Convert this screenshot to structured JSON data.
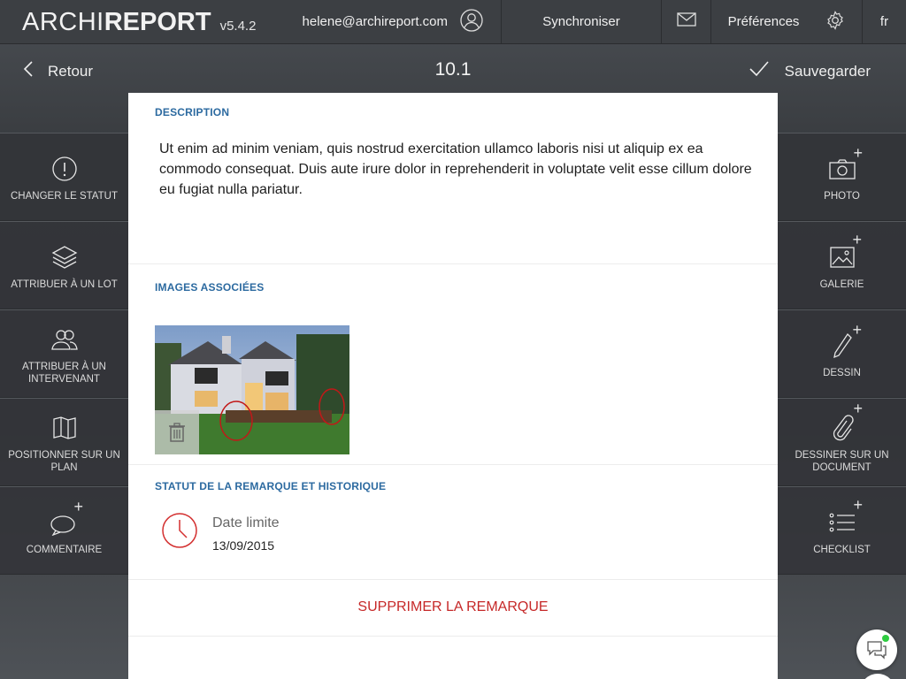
{
  "topbar": {
    "brand_light": "ARCHI",
    "brand_bold": "REPORT",
    "version": "v5.4.2",
    "user_email": "helene@archireport.com",
    "sync_label": "Synchroniser",
    "prefs_label": "Préférences",
    "lang": "fr"
  },
  "navbar": {
    "back_label": "Retour",
    "title": "10.1",
    "save_label": "Sauvegarder"
  },
  "left_actions": [
    {
      "label": "CHANGER LE STATUT",
      "icon": "alert-circle-icon"
    },
    {
      "label": "ATTRIBUER À UN LOT",
      "icon": "layers-icon"
    },
    {
      "label": "ATTRIBUER À UN INTERVENANT",
      "icon": "users-icon"
    },
    {
      "label": "POSITIONNER SUR UN PLAN",
      "icon": "map-icon"
    },
    {
      "label": "COMMENTAIRE",
      "icon": "comment-add-icon"
    }
  ],
  "right_actions": [
    {
      "label": "PHOTO",
      "icon": "camera-add-icon"
    },
    {
      "label": "GALERIE",
      "icon": "gallery-add-icon"
    },
    {
      "label": "DESSIN",
      "icon": "pencil-add-icon"
    },
    {
      "label": "DESSINER SUR UN DOCUMENT",
      "icon": "paperclip-add-icon"
    },
    {
      "label": "CHECKLIST",
      "icon": "checklist-add-icon"
    }
  ],
  "sheet": {
    "description_title": "DESCRIPTION",
    "description_text": "Ut enim ad minim veniam, quis nostrud exercitation ullamco laboris nisi ut aliquip ex ea commodo consequat. Duis aute irure dolor in reprehenderit in voluptate velit esse cillum dolore eu fugiat nulla pariatur.",
    "images_title": "IMAGES ASSOCIÉES",
    "status_title": "STATUT DE LA REMARQUE ET HISTORIQUE",
    "deadline_label": "Date limite",
    "deadline_date": "13/09/2015",
    "delete_label": "SUPPRIMER LA REMARQUE"
  },
  "colors": {
    "accent_blue": "#2c6aa0",
    "danger_red": "#c62828",
    "online_green": "#2ecc40"
  }
}
